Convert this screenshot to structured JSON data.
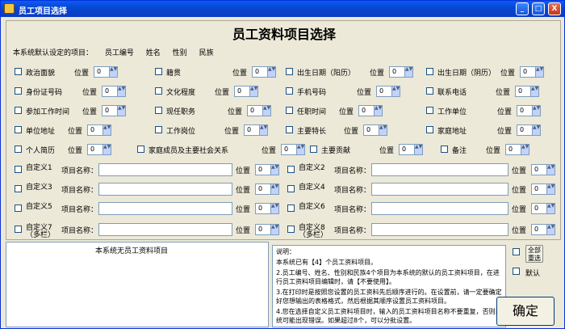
{
  "window": {
    "title": "员工项目选择",
    "minimize": "_",
    "maximize": "□",
    "close": "X"
  },
  "heading": "员工资料项目选择",
  "defaults": {
    "label": "本系统默认设定的项目：",
    "items": [
      "员工编号",
      "姓名",
      "性别",
      "民族"
    ]
  },
  "position_label": "位置",
  "position_value": "0",
  "items": [
    "政治面貌",
    "籍贯",
    "出生日期（阳历）",
    "出生日期（阴历）",
    "身份证号码",
    "文化程度",
    "手机号码",
    "联系电话",
    "参加工作时间",
    "现任职务",
    "任职时间",
    "工作单位",
    "单位地址",
    "工作岗位",
    "主要特长",
    "家庭地址",
    "个人简历",
    "家庭成员及主要社会关系",
    "主要贡献",
    "备注"
  ],
  "custom": {
    "labels": [
      "自定义1",
      "自定义2",
      "自定义3",
      "自定义4",
      "自定义5",
      "自定义6",
      "自定义7（多栏）",
      "自定义8（多栏）"
    ],
    "name_label": "项目名称："
  },
  "bottom_text": "本系统无员工资料项目",
  "note": {
    "title": "说明：",
    "lines": [
      "本系统已有【4】个员工资料项目。",
      "2.员工编号、姓名、性别和民族4个项目为本系统的默认的员工资料项目，在进行员工资料项目编辑时，请【不要使用】。",
      "3.在打印时是按照您设置的员工资料先后顺序进行的。在设置前，请一定要确定好您想输出的表格格式，然后根据其顺序设置员工资料项目。",
      "4.您在选择自定义员工资料项目时，输入的员工资料项目名称不要重复，否则系统可能出现错误。如果超过8个，可以分批设置。"
    ]
  },
  "buttons": {
    "select_all": "全部重选",
    "default": "默认",
    "confirm": "确定"
  }
}
